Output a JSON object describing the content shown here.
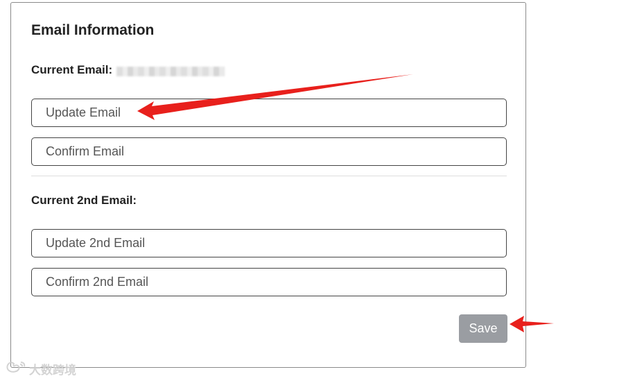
{
  "section": {
    "title": "Email Information",
    "current_email_label": "Current Email:",
    "current_2nd_email_label": "Current 2nd Email:"
  },
  "fields": {
    "update_email_placeholder": "Update Email",
    "confirm_email_placeholder": "Confirm Email",
    "update_2nd_email_placeholder": "Update 2nd Email",
    "confirm_2nd_email_placeholder": "Confirm 2nd Email"
  },
  "actions": {
    "save_label": "Save"
  },
  "watermark": {
    "text": "大数跨境"
  },
  "colors": {
    "annotation_arrow": "#e8201c",
    "save_button_bg": "#9a9da2",
    "input_border": "#444444",
    "card_border": "#8a8a8a"
  },
  "icons": {
    "watermark_logo": "weibo-logo"
  }
}
